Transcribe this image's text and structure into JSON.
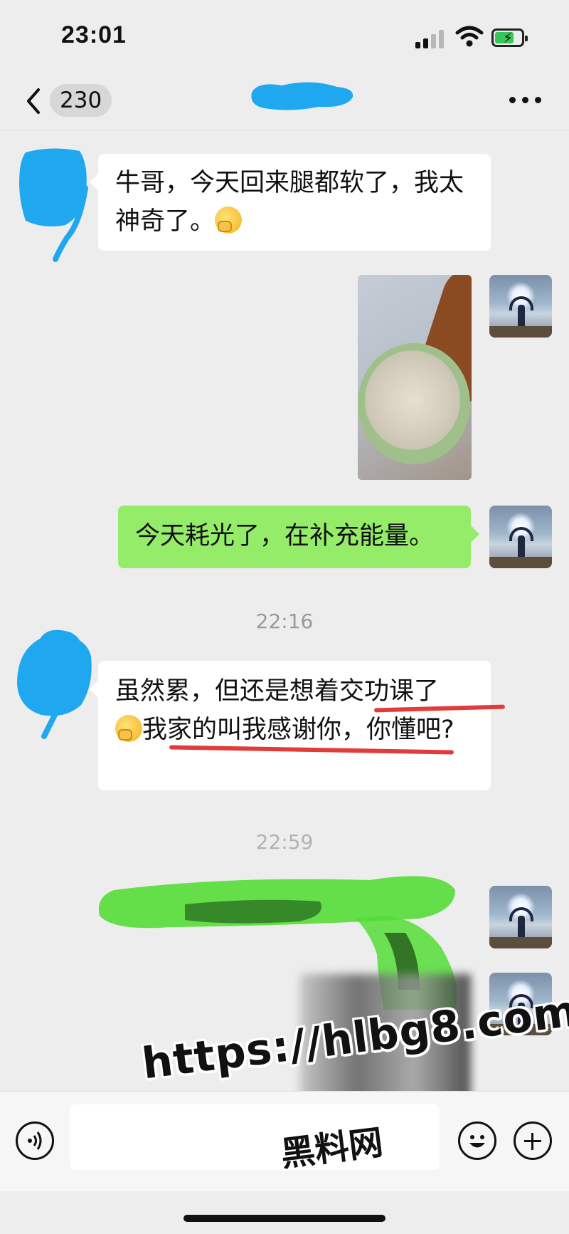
{
  "status_bar": {
    "time": "23:01",
    "icons": [
      "signal-icon",
      "wifi-icon",
      "battery-charging-icon"
    ],
    "battery_color": "#35c759"
  },
  "nav": {
    "back_icon": "chevron-left-icon",
    "unread_count": "230",
    "title": "",
    "more_icon": "more-horizontal-icon"
  },
  "messages": [
    {
      "side": "left",
      "type": "text",
      "text_before": "牛哥，今天回来腿都软了，我太神奇了。",
      "emoji": "smirk-emoji"
    },
    {
      "side": "right",
      "type": "image",
      "description": "dumpling-soup-photo"
    },
    {
      "side": "right",
      "type": "text",
      "text": "今天耗光了，在补充能量。"
    },
    {
      "type": "timestamp",
      "text": "22:16"
    },
    {
      "side": "left",
      "type": "text",
      "text_line1": "虽然累，但还是想着交功课了",
      "emoji": "smirk-emoji",
      "text_line2": "我家的叫我感谢你，你懂吧?"
    },
    {
      "type": "timestamp",
      "text": "22:59"
    }
  ],
  "colors": {
    "background": "#ededed",
    "bubble_self": "#95ec69",
    "bubble_other": "#ffffff",
    "redaction_blue": "#1fa8ef",
    "redaction_green": "#54dd36",
    "underline_red": "#e23b3b"
  },
  "input_bar": {
    "voice_icon": "voice-icon",
    "emoji_icon": "emoji-face-icon",
    "plus_icon": "plus-icon"
  },
  "watermark": {
    "url": "https://hlbg8.com",
    "name": "黑料网"
  }
}
